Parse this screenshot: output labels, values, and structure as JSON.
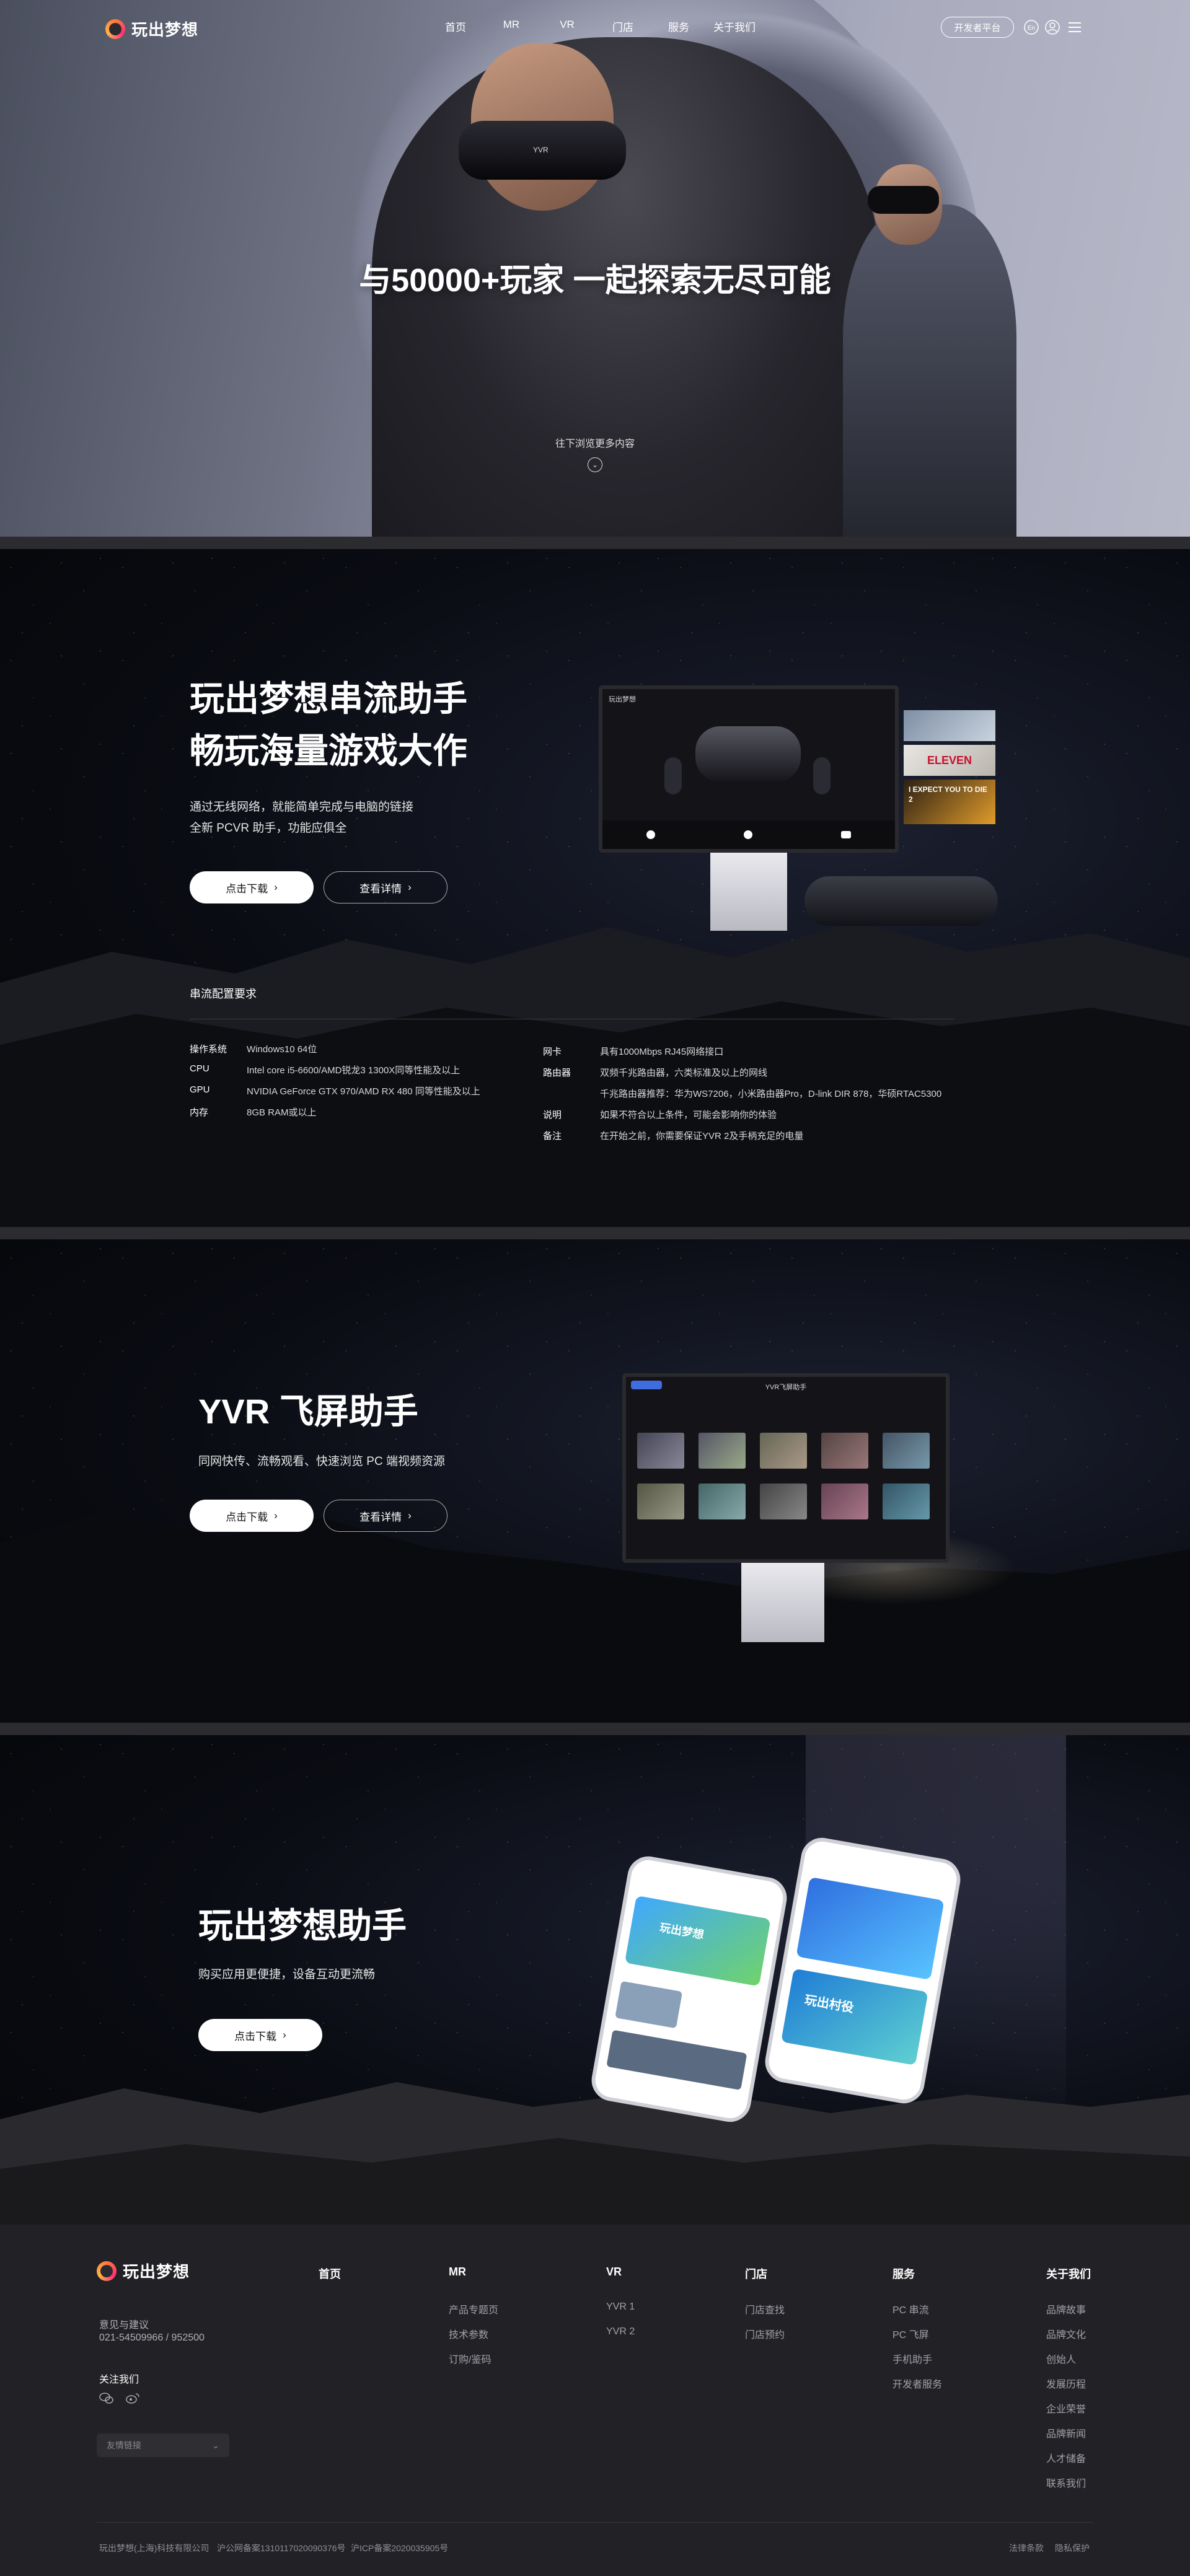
{
  "nav": {
    "logo": "玩出梦想",
    "menu": [
      "首页",
      "MR",
      "VR",
      "门店",
      "服务",
      "关于我们"
    ],
    "dev_platform": "开发者平台",
    "lang": "En"
  },
  "hero": {
    "title": "与50000+玩家 一起探索无尽可能",
    "hint": "往下浏览更多内容",
    "visor_brand": "YVR"
  },
  "stream": {
    "title_line1": "玩出梦想串流助手",
    "title_line2": "畅玩海量游戏大作",
    "desc_line1": "通过无线网络，就能简单完成与电脑的链接",
    "desc_line2": "全新 PCVR 助手，功能应俱全",
    "download": "点击下载",
    "details": "查看详情",
    "screen_logo": "玩出梦想",
    "req_title": "串流配置要求",
    "req_left": [
      {
        "k": "操作系统",
        "v": "Windows10 64位"
      },
      {
        "k": "CPU",
        "v": "Intel core i5-6600/AMD锐龙3 1300X同等性能及以上"
      },
      {
        "k": "GPU",
        "v": "NVIDIA GeForce GTX 970/AMD RX 480 同等性能及以上"
      },
      {
        "k": "内存",
        "v": "8GB RAM或以上"
      }
    ],
    "req_right": [
      {
        "k": "网卡",
        "v": "具有1000Mbps RJ45网络接口"
      },
      {
        "k": "路由器",
        "v": "双频千兆路由器，六类标准及以上的网线"
      },
      {
        "k": "",
        "v": "千兆路由器推荐：华为WS7206，小米路由器Pro，D-link DIR 878，华硕RTAC5300"
      },
      {
        "k": "说明",
        "v": "如果不符合以上条件，可能会影响你的体验"
      },
      {
        "k": "备注",
        "v": "在开始之前，你需要保证YVR 2及手柄充足的电量"
      }
    ],
    "game_tiles": [
      "ELEVEN",
      "I EXPECT YOU TO DIE 2"
    ]
  },
  "screen": {
    "title": "YVR 飞屏助手",
    "desc": "同网快传、流畅观看、快速浏览 PC 端视频资源",
    "download": "点击下载",
    "details": "查看详情",
    "app_title": "YVR飞屏助手"
  },
  "assistant": {
    "title": "玩出梦想助手",
    "desc": "购买应用更便捷，设备互动更流畅",
    "download": "点击下载",
    "phone_banner": "玩出梦想",
    "phone2_banner": "玩出村役"
  },
  "footer": {
    "logo": "玩出梦想",
    "feedback": "意见与建议",
    "phone": "021-54509966 / 952500",
    "follow": "关注我们",
    "select": "友情链接",
    "columns": [
      {
        "title": "首页",
        "links": []
      },
      {
        "title": "MR",
        "links": [
          "产品专题页",
          "技术参数",
          "订购/鉴码"
        ]
      },
      {
        "title": "VR",
        "links": [
          "YVR 1",
          "YVR 2"
        ]
      },
      {
        "title": "门店",
        "links": [
          "门店查找",
          "门店预约"
        ]
      },
      {
        "title": "服务",
        "links": [
          "PC 串流",
          "PC 飞屏",
          "手机助手",
          "开发者服务"
        ]
      },
      {
        "title": "关于我们",
        "links": [
          "品牌故事",
          "品牌文化",
          "创始人",
          "发展历程",
          "企业荣誉",
          "品牌新闻",
          "人才储备",
          "联系我们"
        ]
      }
    ],
    "company": "玩出梦想(上海)科技有限公司",
    "police": "沪公网备案1310117020090376号",
    "icp": "沪ICP备案2020035905号",
    "legal": "法律条款",
    "privacy": "隐私保护"
  },
  "colors": {
    "accent": "#ff6a3c",
    "footer_bg": "#222226",
    "separator": "#2c2c30"
  }
}
